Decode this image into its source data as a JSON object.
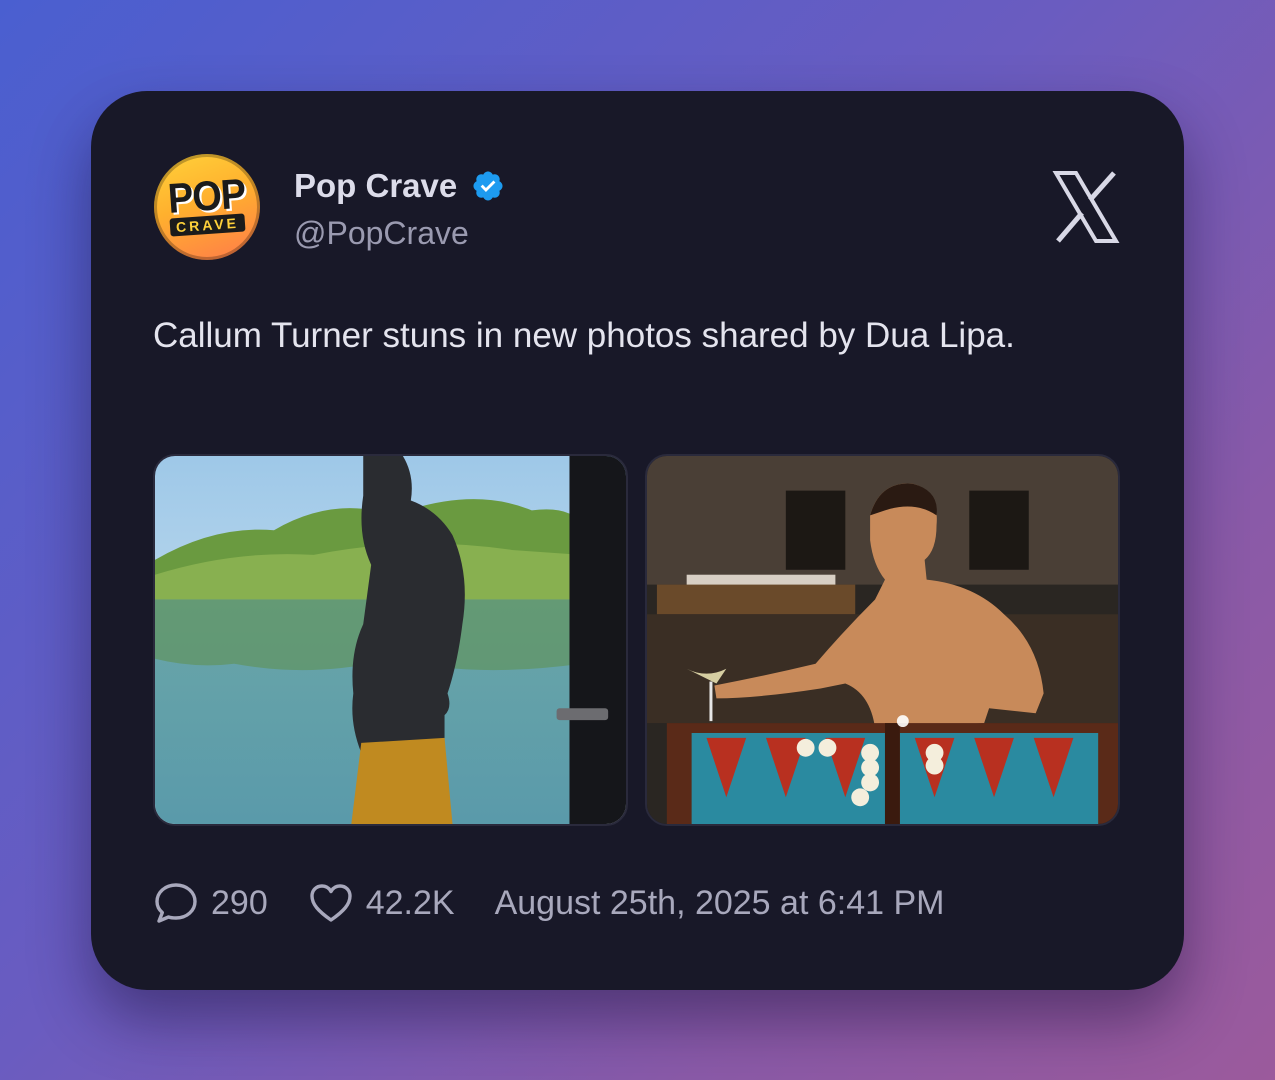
{
  "tweet": {
    "display_name": "Pop Crave",
    "handle": "@PopCrave",
    "verified": true,
    "avatar": {
      "top_text": "POP",
      "bottom_text": "CRAVE"
    },
    "text": "Callum Turner stuns in new photos shared by Dua Lipa.",
    "media": [
      {
        "icon": "photo-lake-shirtless-man"
      },
      {
        "icon": "photo-backgammon-shirtless-man"
      }
    ],
    "replies": "290",
    "likes": "42.2K",
    "timestamp": "August 25th, 2025 at 6:41 PM"
  },
  "colors": {
    "card_bg": "#181828",
    "verified_blue": "#1d9bf0",
    "text_primary": "#e4e4ee",
    "text_muted": "#9a9ab0"
  },
  "icons": {
    "brand": "x-logo-icon",
    "reply": "speech-bubble-icon",
    "like": "heart-icon",
    "verified": "verified-badge-icon"
  }
}
